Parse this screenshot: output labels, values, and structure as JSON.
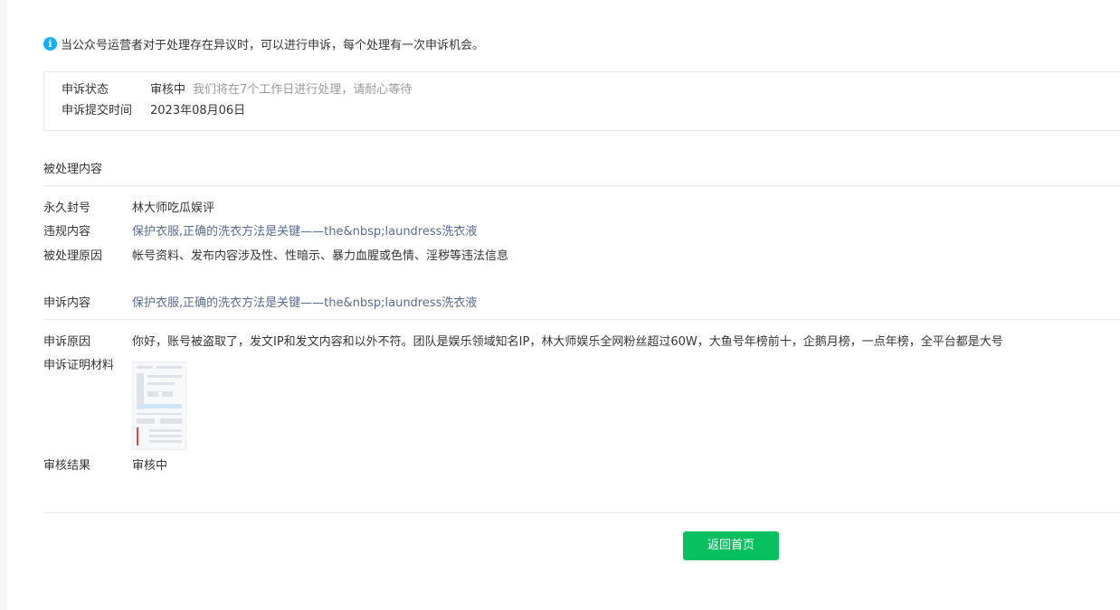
{
  "notice": {
    "icon": "info-icon",
    "text": "当公众号运营者对于处理存在异议时，可以进行申诉，每个处理有一次申诉机会。"
  },
  "status": {
    "state_label": "申诉状态",
    "state_value": "审核中",
    "state_hint": "我们将在7个工作日进行处理，请耐心等待",
    "submit_label": "申诉提交时间",
    "submit_value": "2023年08月06日"
  },
  "processed": {
    "title": "被处理内容",
    "rows": [
      {
        "label": "永久封号",
        "value": "林大师吃瓜娱评",
        "link": false
      },
      {
        "label": "违规内容",
        "value": "保护衣服,正确的洗衣方法是关键——the&nbsp;laundress洗衣液",
        "link": true
      },
      {
        "label": "被处理原因",
        "value": "帐号资料、发布内容涉及性、性暗示、暴力血腥或色情、淫秽等违法信息",
        "link": false
      }
    ]
  },
  "appeal": {
    "content_label": "申诉内容",
    "content_value": "保护衣服,正确的洗衣方法是关键——the&nbsp;laundress洗衣液",
    "reason_label": "申诉原因",
    "reason_value": "你好，账号被盗取了，发文IP和发文内容和以外不符。团队是娱乐领域知名IP，林大师娱乐全网粉丝超过60W，大鱼号年榜前十，企鹅月榜，一点年榜，全平台都是大号",
    "evidence_label": "申诉证明材料",
    "result_label": "审核结果",
    "result_value": "审核中"
  },
  "actions": {
    "back_label": "返回首页"
  },
  "colors": {
    "primary": "#07c160",
    "link": "#576b95",
    "info": "#10aeff",
    "hint": "#9a9a9a",
    "border": "#e4e8eb"
  }
}
